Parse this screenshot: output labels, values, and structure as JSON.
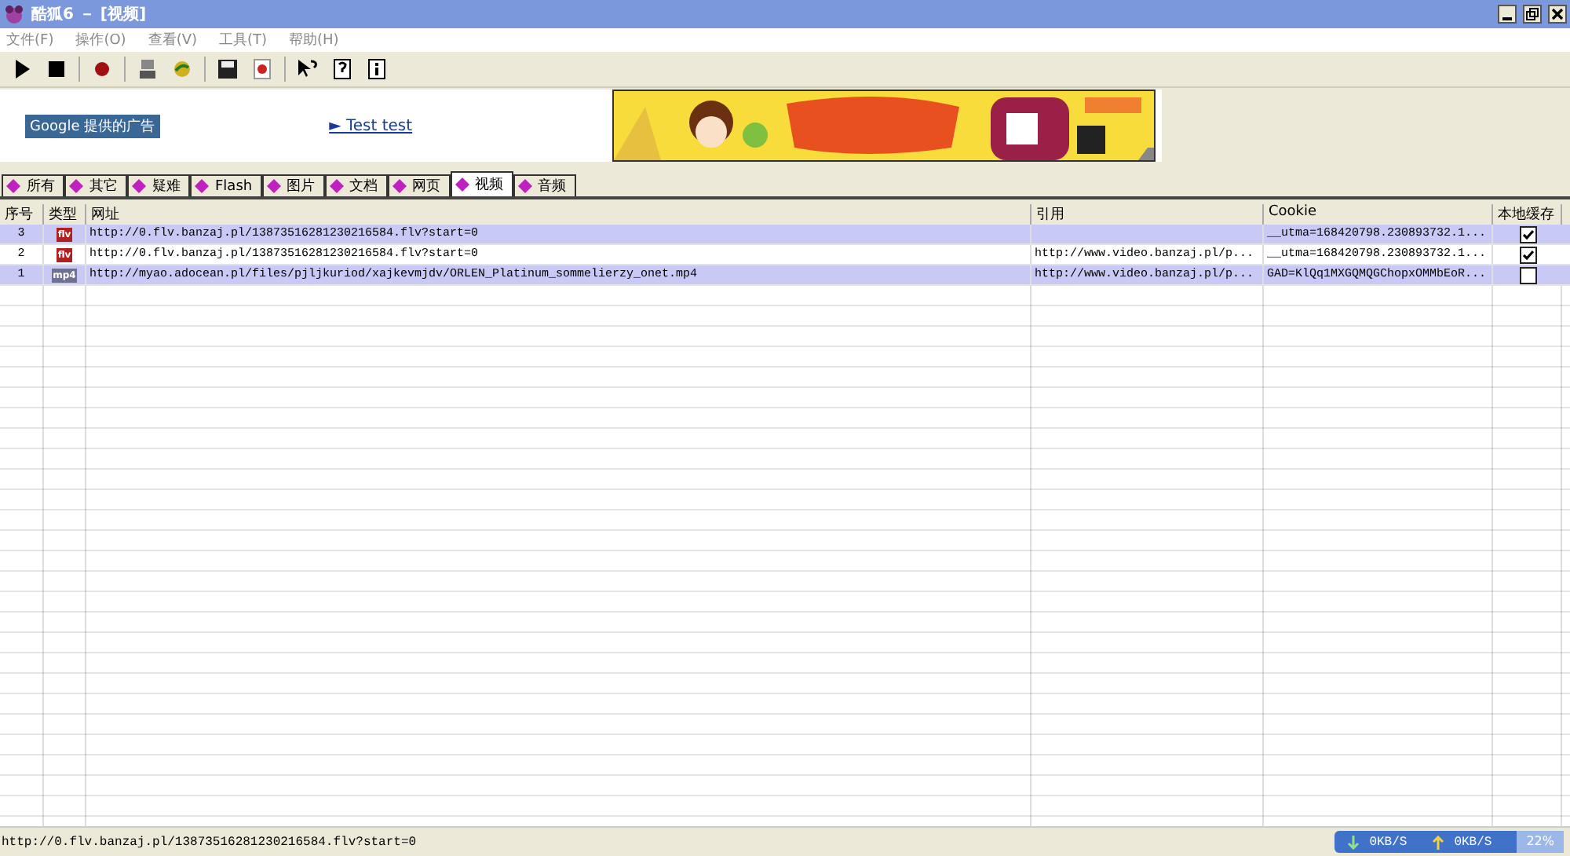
{
  "window": {
    "title": "酷狐6 － [视频]"
  },
  "menu": [
    "文件(F)",
    "操作(O)",
    "查看(V)",
    "工具(T)",
    "帮助(H)"
  ],
  "ad": {
    "label": "Google 提供的广告",
    "link": "► Test test"
  },
  "tabs": [
    {
      "label": "所有",
      "selected": false
    },
    {
      "label": "其它",
      "selected": false
    },
    {
      "label": "疑难",
      "selected": false
    },
    {
      "label": "Flash",
      "selected": false
    },
    {
      "label": "图片",
      "selected": false
    },
    {
      "label": "文档",
      "selected": false
    },
    {
      "label": "网页",
      "selected": false
    },
    {
      "label": "视频",
      "selected": true
    },
    {
      "label": "音频",
      "selected": false
    }
  ],
  "table": {
    "columns": [
      "序号",
      "类型",
      "网址",
      "引用",
      "Cookie",
      "本地缓存"
    ],
    "rows": [
      {
        "index": "3",
        "file_type": "flv",
        "url": "http://0.flv.banzaj.pl/13873516281230216584.flv?start=0",
        "referer": "",
        "cookie": "__utma=168420798.230893732.1...",
        "cached": true,
        "selected": true
      },
      {
        "index": "2",
        "file_type": "flv",
        "url": "http://0.flv.banzaj.pl/13873516281230216584.flv?start=0",
        "referer": "http://www.video.banzaj.pl/p...",
        "cookie": "__utma=168420798.230893732.1...",
        "cached": true,
        "selected": false
      },
      {
        "index": "1",
        "file_type": "mp4",
        "url": "http://myao.adocean.pl/files/pjljkuriod/xajkevmjdv/ORLEN_Platinum_sommelierzy_onet.mp4",
        "referer": "http://www.video.banzaj.pl/p...",
        "cookie": "GAD=KlQq1MXGQMQGChopxOMMbEoR...",
        "cached": false,
        "selected": true
      }
    ]
  },
  "status_bar": {
    "text": "http://0.flv.banzaj.pl/13873516281230216584.flv?start=0",
    "download": "0KB/S",
    "upload": "0KB/S",
    "percent": "22%"
  }
}
